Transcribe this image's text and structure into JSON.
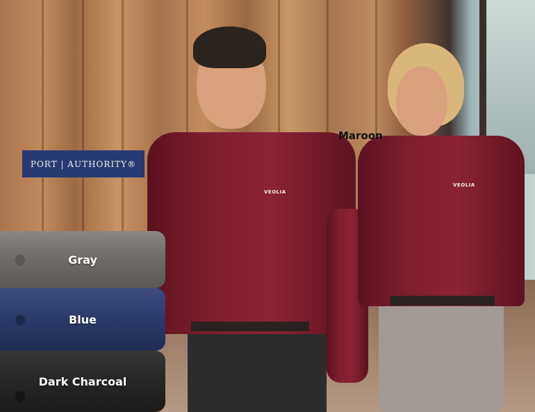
{
  "brand": {
    "logo_text": "PORT | AUTHORITY®"
  },
  "labels": {
    "maroon": "Maroon"
  },
  "swatches": [
    {
      "label": "Gray",
      "color": "#75716d"
    },
    {
      "label": "Blue",
      "color": "#2c3d6b"
    },
    {
      "label": "Dark Charcoal",
      "color": "#2a2927"
    }
  ],
  "shirt_logo_text": "VEOLIA",
  "colors": {
    "maroon": "#7e1e2e",
    "brand_bg": "#283a72"
  }
}
